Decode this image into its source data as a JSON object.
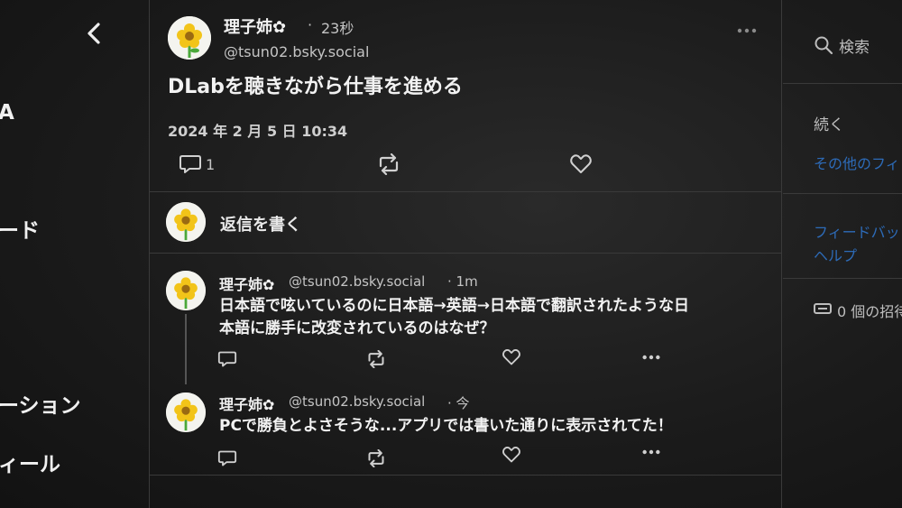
{
  "left_nav": {
    "items": [
      {
        "label": "A"
      },
      {
        "label": "ード"
      },
      {
        "label": "ーション"
      },
      {
        "label": "ィール"
      }
    ]
  },
  "post": {
    "author": "理子姉✿",
    "separator": "·",
    "time": "23秒",
    "handle": "@tsun02.bsky.social",
    "text": "DLabを聴きながら仕事を進める",
    "date": "2024 年 2 月 5 日 10:34",
    "reply_count": "1"
  },
  "reply_box": {
    "placeholder": "返信を書く"
  },
  "replies": [
    {
      "author": "理子姉✿",
      "handle": "@tsun02.bsky.social",
      "time": "· 1m",
      "line1": "日本語で呟いているのに日本語→英語→日本語で翻訳されたような日",
      "line2": "本語に勝手に改変されているのはなぜ？"
    },
    {
      "author": "理子姉✿",
      "handle": "@tsun02.bsky.social",
      "time": "· 今",
      "line1": "PCで勝負とよさそうな...アプリでは書いた通りに表示されてた！"
    }
  ],
  "right_sidebar": {
    "search_label": "検索",
    "follow_label": "続く",
    "other_feeds": "その他のフィ",
    "feedback": "フィードバッ",
    "help": "ヘルプ",
    "invites": "0 個の招待"
  },
  "colors": {
    "link": "#2d6bb8",
    "background": "#1c1c1c",
    "divider": "#3a3a3a"
  }
}
